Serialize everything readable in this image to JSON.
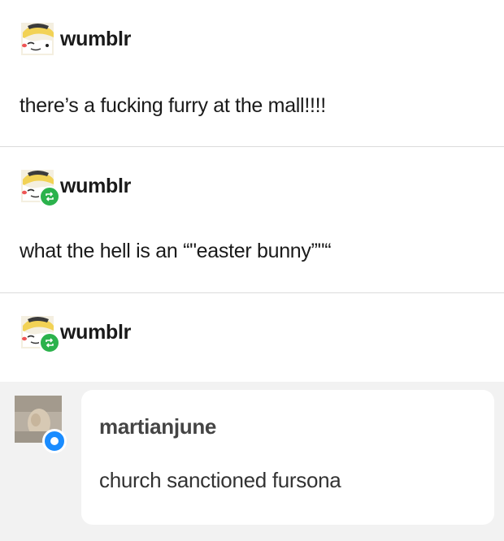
{
  "posts": [
    {
      "username": "wumblr",
      "text": "there’s a fucking furry at the mall!!!!",
      "reblogged": false
    },
    {
      "username": "wumblr",
      "text": "what the hell is an “\"easter bunny”\"“",
      "reblogged": true
    },
    {
      "username": "wumblr",
      "text": "",
      "reblogged": true
    }
  ],
  "reply": {
    "username": "martianjune",
    "text": "church sanctioned fursona"
  },
  "colors": {
    "reblog_badge": "#2bb24c",
    "reply_badge": "#1a8cff",
    "reply_background": "#f2f2f2"
  },
  "icons": {
    "avatar": "isabelle-avatar-icon",
    "reblog": "reblog-icon",
    "reply_avatar": "user-avatar-icon"
  }
}
